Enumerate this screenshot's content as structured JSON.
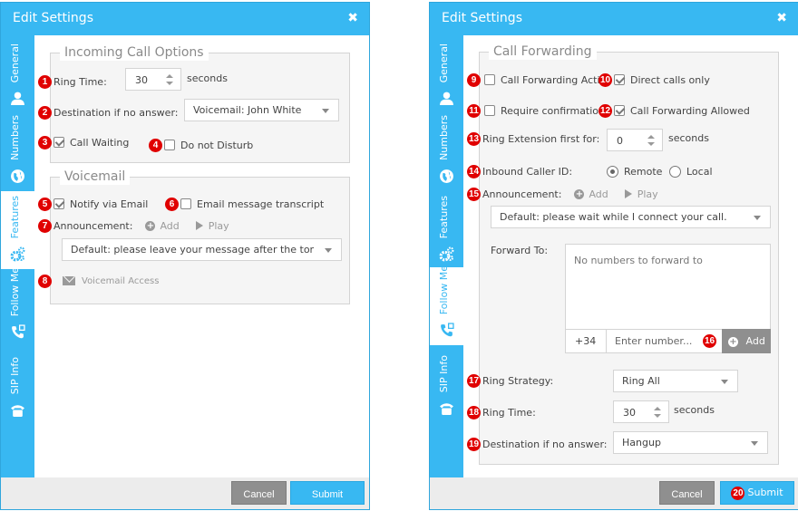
{
  "left_modal": {
    "title": "Edit Settings",
    "close_label": "✖",
    "tabs": [
      {
        "label": "General",
        "icon": "user-icon",
        "active": false
      },
      {
        "label": "Numbers",
        "icon": "globe-icon",
        "active": false
      },
      {
        "label": "Features",
        "icon": "gears-icon",
        "active": true
      },
      {
        "label": "Follow Me",
        "icon": "phone-forward-icon",
        "active": false
      },
      {
        "label": "SIP Info",
        "icon": "telephone-icon",
        "active": false
      }
    ],
    "incoming": {
      "legend": "Incoming Call Options",
      "ring_time_label": "Ring Time:",
      "ring_time_value": "30",
      "ring_time_unit": "seconds",
      "destination_label": "Destination if no answer:",
      "destination_value": "Voicemail: John White",
      "call_waiting_label": "Call Waiting",
      "call_waiting_checked": true,
      "dnd_label": "Do not Disturb",
      "dnd_checked": false
    },
    "voicemail": {
      "legend": "Voicemail",
      "notify_label": "Notify via Email",
      "notify_checked": true,
      "transcript_label": "Email message transcript",
      "transcript_checked": false,
      "announcement_label": "Announcement:",
      "add_label": "Add",
      "play_label": "Play",
      "announcement_value": "Default: please leave your message after the tone. Wh",
      "access_label": "Voicemail Access"
    },
    "badges": [
      "1",
      "2",
      "3",
      "4",
      "5",
      "6",
      "7",
      "8"
    ],
    "cancel_label": "Cancel",
    "submit_label": "Submit"
  },
  "right_modal": {
    "title": "Edit Settings",
    "close_label": "✖",
    "tabs": [
      {
        "label": "General",
        "icon": "user-icon",
        "active": false
      },
      {
        "label": "Numbers",
        "icon": "globe-icon",
        "active": false
      },
      {
        "label": "Features",
        "icon": "gears-icon",
        "active": false
      },
      {
        "label": "Follow Me",
        "icon": "phone-forward-icon",
        "active": true
      },
      {
        "label": "SIP Info",
        "icon": "telephone-icon",
        "active": false
      }
    ],
    "forwarding": {
      "legend": "Call Forwarding",
      "active_label": "Call Forwarding Active",
      "active_checked": false,
      "direct_label": "Direct calls only",
      "direct_checked": true,
      "confirm_label": "Require confirmation",
      "confirm_checked": false,
      "allowed_label": "Call Forwarding Allowed",
      "allowed_checked": true,
      "ring_ext_label": "Ring Extension first for:",
      "ring_ext_value": "0",
      "ring_ext_unit": "seconds",
      "caller_id_label": "Inbound Caller ID:",
      "caller_id_options": [
        "Remote",
        "Local"
      ],
      "caller_id_selected": "Remote",
      "announcement_label": "Announcement:",
      "add_label": "Add",
      "play_label": "Play",
      "announcement_value": "Default: please wait while I connect your call.",
      "forward_to_label": "Forward To:",
      "forward_empty": "No numbers to forward to",
      "prefix": "+34",
      "number_placeholder": "Enter number...",
      "add_number_label": "Add",
      "ring_strategy_label": "Ring Strategy:",
      "ring_strategy_value": "Ring All",
      "ring_time_label": "Ring Time:",
      "ring_time_value": "30",
      "ring_time_unit": "seconds",
      "destination_label": "Destination if no answer:",
      "destination_value": "Hangup"
    },
    "badges": [
      "9",
      "10",
      "11",
      "12",
      "13",
      "14",
      "15",
      "16",
      "17",
      "18",
      "19",
      "20"
    ],
    "cancel_label": "Cancel",
    "submit_label": "Submit"
  },
  "colors": {
    "accent": "#38b8f2",
    "badge": "#e00000",
    "cancel": "#8f8f8f",
    "panel": "#f5f5f5"
  }
}
